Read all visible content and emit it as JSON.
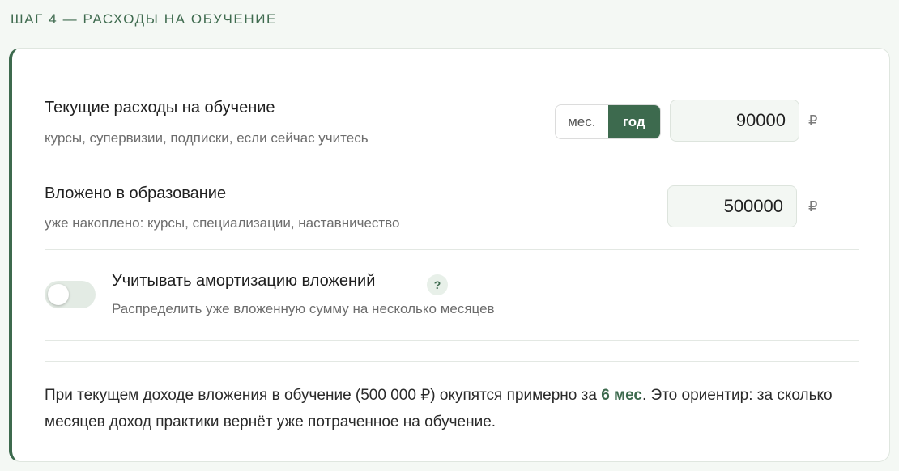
{
  "step_title": "ШАГ 4 — РАСХОДЫ НА ОБУЧЕНИЕ",
  "current_expenses": {
    "label": "Текущие расходы на обучение",
    "hint": "курсы, супервизии, подписки, если сейчас учитесь",
    "period_options": [
      "мес.",
      "год"
    ],
    "selected_period": "год",
    "value": "90000",
    "currency": "₽"
  },
  "invested": {
    "label": "Вложено в образование",
    "hint": "уже накоплено: курсы, специализации, наставничество",
    "value": "500000",
    "currency": "₽"
  },
  "amortization": {
    "label": "Учитывать амортизацию вложений",
    "hint": "Распределить уже вложенную сумму на несколько месяцев",
    "help_symbol": "?",
    "enabled": false
  },
  "summary": {
    "part1": "При текущем доходе вложения в обучение (500 000 ₽) окупятся примерно за ",
    "highlight": "6 мес",
    "part2": ". Это ориентир: за сколько месяцев доход практики вернёт уже потраченное на обучение."
  },
  "colors": {
    "accent": "#3d6a4e",
    "background": "#f4f8f4"
  }
}
